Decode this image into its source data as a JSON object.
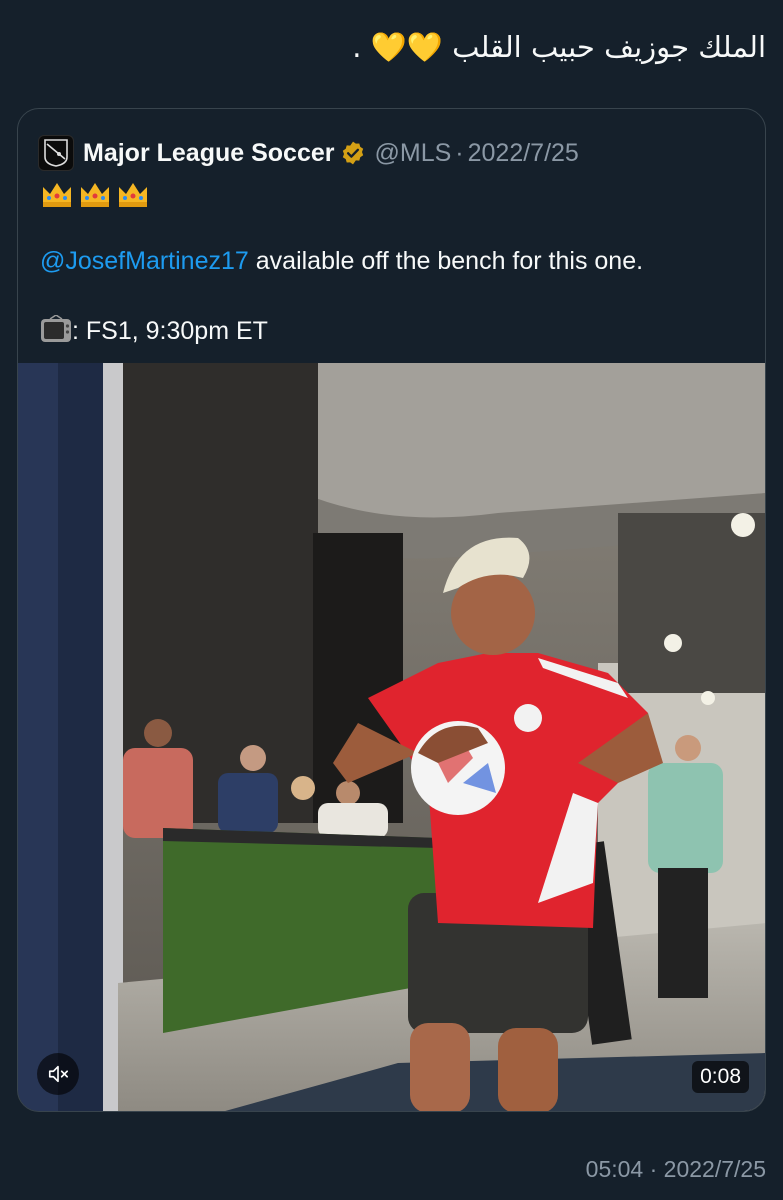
{
  "tweet": {
    "text_prefix": "الملك جوزيف حبيب القلب",
    "text_suffix": "."
  },
  "quote": {
    "author_name": "Major League Soccer",
    "handle": "@MLS",
    "separator": "·",
    "date": "2022/7/25",
    "mention": "@JosefMartinez17",
    "line1_rest": " available off the bench for this one.",
    "line2": ": FS1, 9:30pm ET",
    "logo_text": "MLS"
  },
  "video": {
    "duration": "0:08"
  },
  "footer": {
    "timestamp": "05:04 · 2022/7/25"
  },
  "colors": {
    "background": "#15202b",
    "link": "#1d9bf0",
    "muted": "#8b98a5",
    "verified": "#d4a015"
  },
  "icons": [
    "yellow-heart-icon",
    "mls-logo",
    "verified-badge-icon",
    "crown-icon",
    "television-icon",
    "mute-icon"
  ]
}
